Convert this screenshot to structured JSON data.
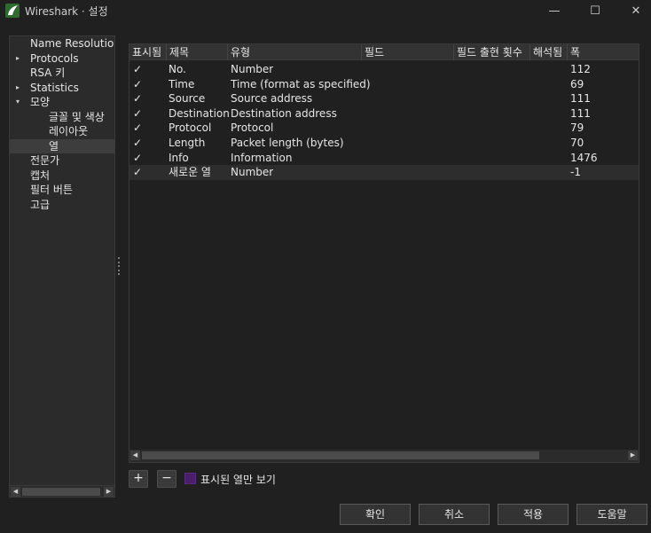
{
  "window": {
    "title": "Wireshark · 설정",
    "minimize_glyph": "—",
    "maximize_glyph": "☐",
    "close_glyph": "✕"
  },
  "colors": {
    "accent": "#4a1f6a",
    "background": "#202020",
    "panel": "#2b2b2b"
  },
  "sidebar": {
    "items": [
      {
        "label": "Name Resolution",
        "arrow": ""
      },
      {
        "label": "Protocols",
        "arrow": "▸"
      },
      {
        "label": "RSA 키",
        "arrow": ""
      },
      {
        "label": "Statistics",
        "arrow": "▸"
      },
      {
        "label": "모양",
        "arrow": "▾"
      },
      {
        "label": "글꼴 및 색상",
        "arrow": ""
      },
      {
        "label": "레이아웃",
        "arrow": ""
      },
      {
        "label": "열",
        "arrow": ""
      },
      {
        "label": "전문가",
        "arrow": ""
      },
      {
        "label": "캡처",
        "arrow": ""
      },
      {
        "label": "필터 버튼",
        "arrow": ""
      },
      {
        "label": "고급",
        "arrow": ""
      }
    ],
    "selected_index": 7
  },
  "table": {
    "headers": [
      "표시됨",
      "제목",
      "유형",
      "필드",
      "필드 출현 횟수",
      "해석됨",
      "폭"
    ],
    "rows": [
      {
        "check": "✓",
        "title": "No.",
        "type": "Number",
        "width": "112"
      },
      {
        "check": "✓",
        "title": "Time",
        "type": "Time (format as specified)",
        "width": "69"
      },
      {
        "check": "✓",
        "title": "Source",
        "type": "Source address",
        "width": "111"
      },
      {
        "check": "✓",
        "title": "Destination",
        "type": "Destination address",
        "width": "111"
      },
      {
        "check": "✓",
        "title": "Protocol",
        "type": "Protocol",
        "width": "79"
      },
      {
        "check": "✓",
        "title": "Length",
        "type": "Packet length (bytes)",
        "width": "70"
      },
      {
        "check": "✓",
        "title": "Info",
        "type": "Information",
        "width": "1476"
      },
      {
        "check": "✓",
        "title": "새로운 열",
        "type": "Number",
        "width": "-1"
      }
    ],
    "selected_index": 7
  },
  "toolbar": {
    "add_label": "+",
    "remove_label": "−",
    "show_displayed_label": "표시된 열만 보기"
  },
  "buttons": {
    "ok": "확인",
    "cancel": "취소",
    "apply": "적용",
    "help": "도움말"
  }
}
